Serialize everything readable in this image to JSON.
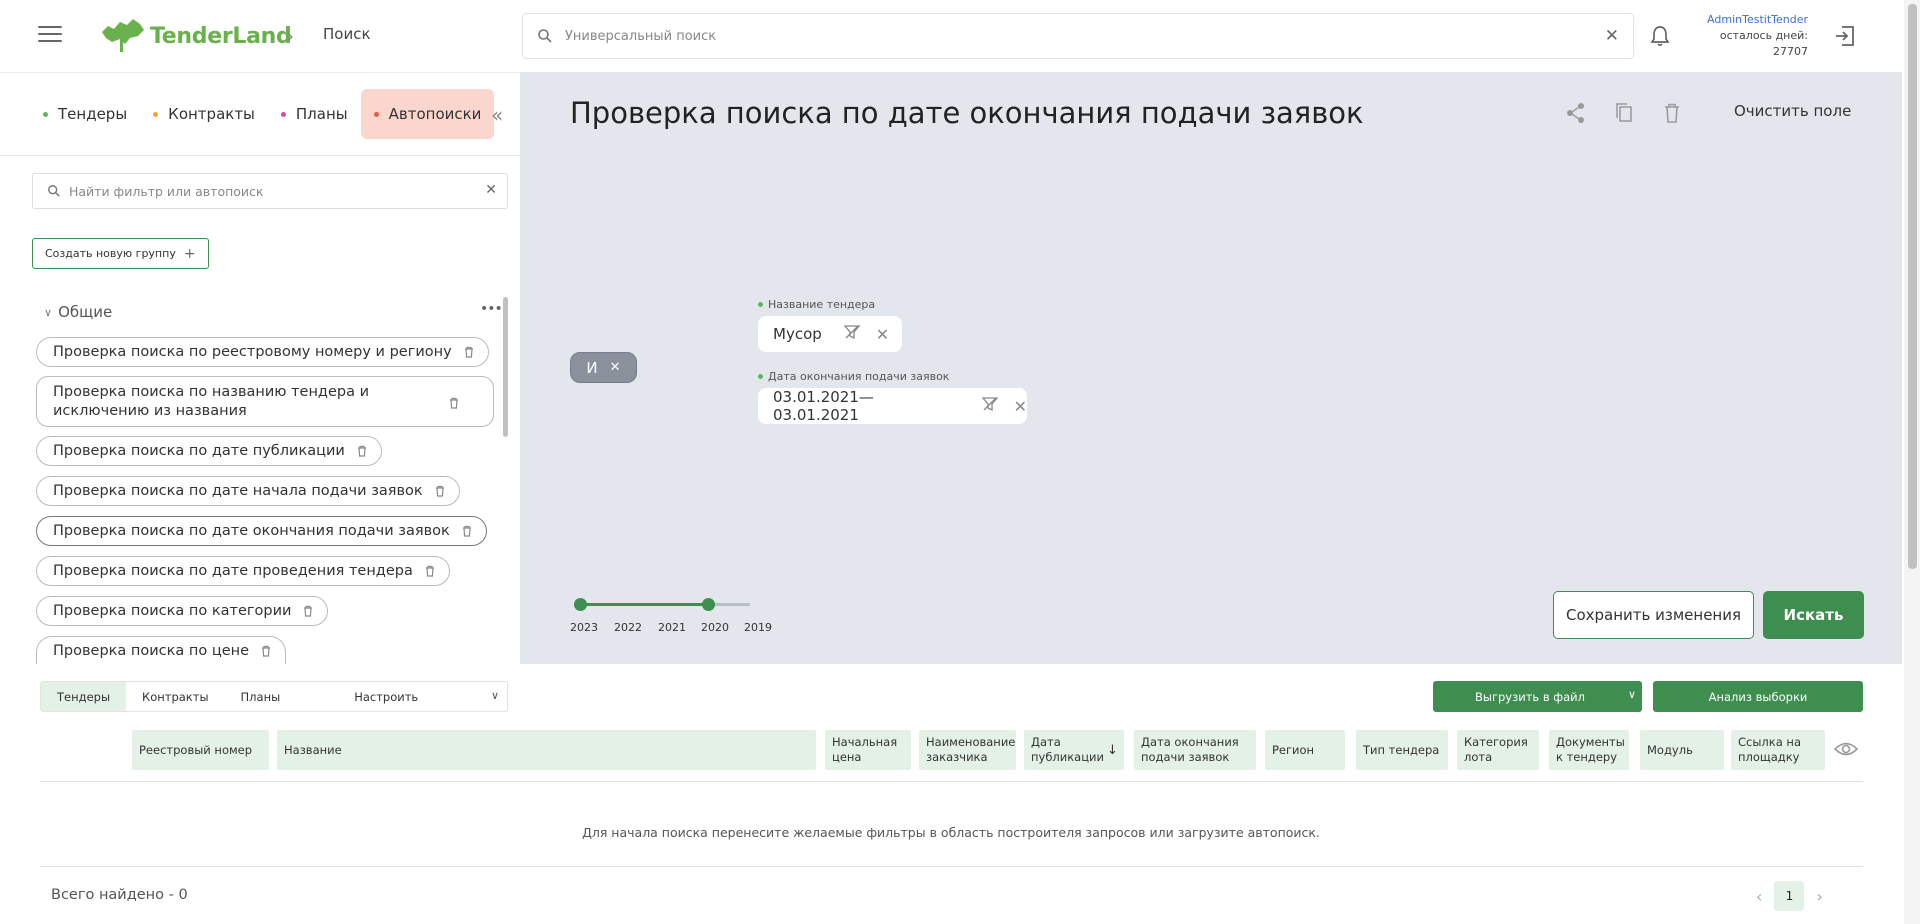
{
  "header": {
    "logo_text": "TenderLand",
    "breadcrumb": "Поиск",
    "search_placeholder": "Универсальный поиск",
    "user_name": "AdminTestitTender",
    "days_left_label": "осталось дней:",
    "days_left": "27707"
  },
  "left_panel": {
    "tabs": [
      {
        "label": "Тендеры",
        "dot_color": "#5fb45f"
      },
      {
        "label": "Контракты",
        "dot_color": "#f0a43c"
      },
      {
        "label": "Планы",
        "dot_color": "#c94fb0"
      },
      {
        "label": "Автопоиски",
        "dot_color": "#e85b4a"
      }
    ],
    "filter_search_placeholder": "Найти фильтр или автопоиск",
    "create_group_label": "Создать новую группу",
    "group_name": "Общие",
    "saved_searches": [
      "Проверка поиска по реестровому номеру и региону",
      "Проверка поиска по названию тендера и исключению из названия",
      "Проверка поиска по дате публикации",
      "Проверка поиска по дате начала подачи заявок",
      "Проверка поиска по дате окончания подачи заявок",
      "Проверка поиска по дате проведения тендера",
      "Проверка поиска по категории",
      "Проверка поиска по цене"
    ]
  },
  "builder": {
    "title": "Проверка поиска по дате окончания подачи заявок",
    "clear_label": "Очистить поле",
    "operator_label": "И",
    "filters": [
      {
        "label": "Название тендера",
        "value": "Мусор"
      },
      {
        "label": "Дата окончания подачи заявок",
        "value": "03.01.2021—03.01.2021"
      }
    ],
    "timeline_years": [
      "2023",
      "2022",
      "2021",
      "2020",
      "2019"
    ],
    "save_label": "Сохранить изменения",
    "search_label": "Искать"
  },
  "results": {
    "tabs": [
      "Тендеры",
      "Контракты",
      "Планы"
    ],
    "configure_label": "Настроить",
    "export_label": "Выгрузить в файл",
    "analyze_label": "Анализ выборки",
    "columns": [
      "Реестровый номер",
      "Название",
      "Начальная цена",
      "Наименование заказчика",
      "Дата публикации",
      "Дата окончания подачи заявок",
      "Регион",
      "Тип тендера",
      "Категория лота",
      "Документы к тендеру",
      "Модуль",
      "Ссылка на площадку"
    ],
    "sort_indicator": "↓",
    "empty_message": "Для начала поиска перенесите желаемые фильтры в область построителя запросов или загрузите автопоиск.",
    "total_label": "Всего найдено - 0",
    "current_page": "1"
  },
  "colors": {
    "brand_green": "#3e8e4f",
    "logo_green": "#6ab04c",
    "active_tab_bg": "#fbd6cf",
    "builder_bg": "#e3e6ed",
    "header_cell_bg": "#e4f1e6"
  }
}
